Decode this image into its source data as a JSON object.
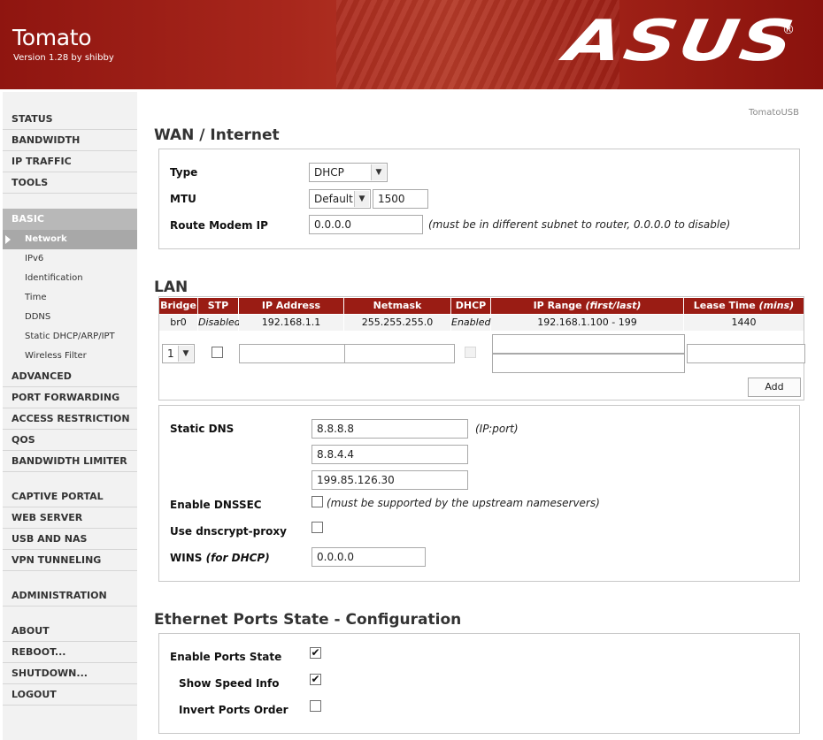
{
  "header": {
    "title": "Tomato",
    "version": "Version 1.28 by shibby",
    "brand": "ASUS",
    "brand_mark": "®"
  },
  "variant_label": "TomatoUSB",
  "sidebar": {
    "items": [
      {
        "label": "STATUS"
      },
      {
        "label": "BANDWIDTH"
      },
      {
        "label": "IP TRAFFIC"
      },
      {
        "label": "TOOLS"
      },
      {
        "label": "BASIC"
      },
      {
        "label": "Network"
      },
      {
        "label": "IPv6"
      },
      {
        "label": "Identification"
      },
      {
        "label": "Time"
      },
      {
        "label": "DDNS"
      },
      {
        "label": "Static DHCP/ARP/IPT"
      },
      {
        "label": "Wireless Filter"
      },
      {
        "label": "ADVANCED"
      },
      {
        "label": "PORT FORWARDING"
      },
      {
        "label": "ACCESS RESTRICTION"
      },
      {
        "label": "QOS"
      },
      {
        "label": "BANDWIDTH LIMITER"
      },
      {
        "label": "CAPTIVE PORTAL"
      },
      {
        "label": "WEB SERVER"
      },
      {
        "label": "USB AND NAS"
      },
      {
        "label": "VPN TUNNELING"
      },
      {
        "label": "ADMINISTRATION"
      },
      {
        "label": "ABOUT"
      },
      {
        "label": "REBOOT..."
      },
      {
        "label": "SHUTDOWN..."
      },
      {
        "label": "LOGOUT"
      }
    ]
  },
  "wan": {
    "title": "WAN / Internet",
    "type_label": "Type",
    "type_value": "DHCP",
    "mtu_label": "MTU",
    "mtu_mode": "Default",
    "mtu_value": "1500",
    "modem_label": "Route Modem IP",
    "modem_value": "0.0.0.0",
    "modem_note": "(must be in different subnet to router, 0.0.0.0 to disable)"
  },
  "lan": {
    "title": "LAN",
    "headers": {
      "bridge": "Bridge",
      "stp": "STP",
      "ip": "IP Address",
      "netmask": "Netmask",
      "dhcp": "DHCP",
      "range_main": "IP Range ",
      "range_em": "(first/last)",
      "lease_main": "Lease Time ",
      "lease_em": "(mins)"
    },
    "row": {
      "bridge": "br0",
      "stp": "Disabled",
      "ip": "192.168.1.1",
      "netmask": "255.255.255.0",
      "dhcp": "Enabled",
      "range": "192.168.1.100 - 199",
      "lease": "1440"
    },
    "new_bridge": "1",
    "add_label": "Add"
  },
  "dns": {
    "static_label": "Static DNS",
    "servers": [
      "8.8.8.8",
      "8.8.4.4",
      "199.85.126.30"
    ],
    "port_note": "(IP:port)",
    "dnssec_label": "Enable DNSSEC",
    "dnssec_note": "(must be supported by the upstream nameservers)",
    "dnscrypt_label": "Use dnscrypt-proxy",
    "wins_label": "WINS ",
    "wins_em": "(for DHCP)",
    "wins_value": "0.0.0.0"
  },
  "ports": {
    "title": "Ethernet Ports State - Configuration",
    "enable_label": "Enable Ports State",
    "speed_label": "Show Speed Info",
    "invert_label": "Invert Ports Order",
    "check_glyph": "✔"
  }
}
